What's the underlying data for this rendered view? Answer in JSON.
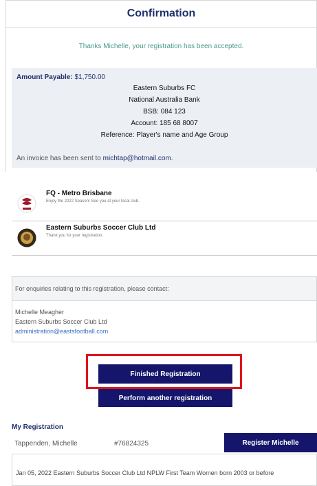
{
  "header": {
    "title": "Confirmation"
  },
  "message": {
    "thanks": "Thanks Michelle, your registration has been accepted."
  },
  "payment": {
    "amount_label": "Amount Payable:",
    "amount_value": "$1,750.00",
    "bank_lines": [
      "Eastern Suburbs FC",
      "National Australia Bank",
      "BSB: 084 123",
      "Account: 185 68 8007",
      "Reference: Player's name and Age Group"
    ],
    "invoice_text": "An invoice has been sent to",
    "invoice_email": "michtap@hotmail.com",
    "invoice_suffix": "."
  },
  "organisations": [
    {
      "name": "FQ - Metro Brisbane",
      "message": "Enjoy the 2022 Season! See you at your local club."
    },
    {
      "name": "Eastern Suburbs Soccer Club Ltd",
      "message": "Thank you for your registration."
    }
  ],
  "enquiry": {
    "heading": "For enquiries relating to this registration, please contact:",
    "contact_name": "Michelle Meagher",
    "contact_org": "Eastern Suburbs Soccer Club Ltd",
    "contact_email": "administration@eastsfootball.com"
  },
  "actions": {
    "finished": "Finished Registration",
    "another": "Perform another registration"
  },
  "my_registration": {
    "title": "My Registration",
    "name": "Tappenden, Michelle",
    "id": "#76824325",
    "register_button": "Register Michelle",
    "history_row": "Jan 05, 2022  Eastern Suburbs Soccer Club Ltd  NPLW First Team Women born 2003 or before"
  },
  "colors": {
    "brand_navy": "#14156b",
    "highlight_red": "#e0141e",
    "panel_bg": "#eceff4"
  },
  "icons": [
    "fq-logo-icon",
    "eastern-suburbs-crest-icon"
  ]
}
